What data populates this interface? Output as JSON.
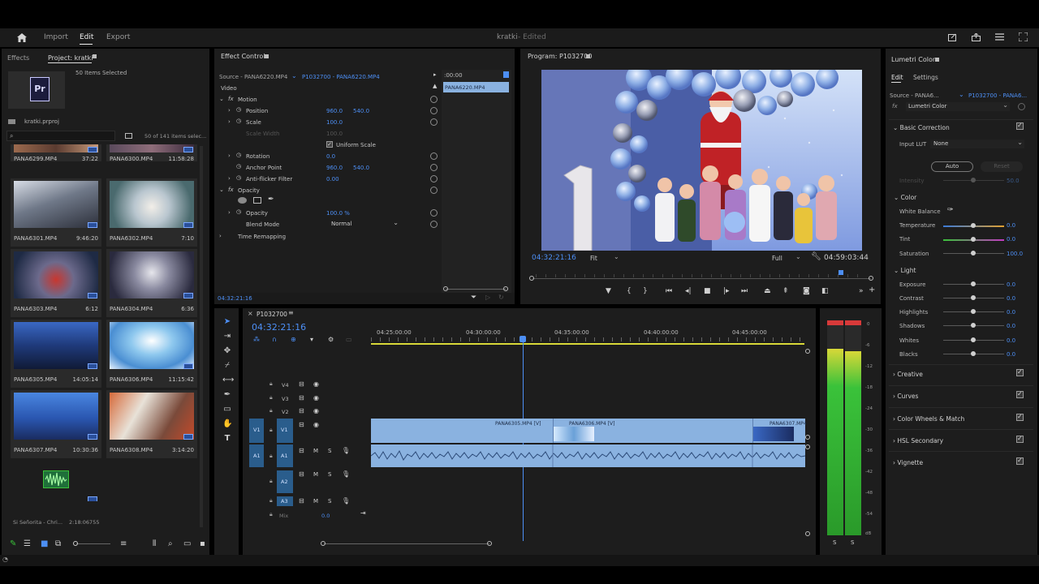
{
  "topbar": {
    "tabs": [
      {
        "label": "Import",
        "active": false
      },
      {
        "label": "Edit",
        "active": true
      },
      {
        "label": "Export",
        "active": false
      }
    ],
    "project_title": "kratki",
    "status": "- Edited"
  },
  "project_panel": {
    "tabs": [
      "Effects",
      "Project: kratki"
    ],
    "selection_info": "50 Items Selected",
    "file_name": "kratki.prproj",
    "item_count": "50 of 141 items selec...",
    "items": [
      {
        "name": "PANA6299.MP4",
        "duration": "37:22"
      },
      {
        "name": "PANA6300.MP4",
        "duration": "11:58:28"
      },
      {
        "name": "PANA6301.MP4",
        "duration": "9:46:20"
      },
      {
        "name": "PANA6302.MP4",
        "duration": "7:10"
      },
      {
        "name": "PANA6303.MP4",
        "duration": "6:12"
      },
      {
        "name": "PANA6304.MP4",
        "duration": "6:36"
      },
      {
        "name": "PANA6305.MP4",
        "duration": "14:05:14"
      },
      {
        "name": "PANA6306.MP4",
        "duration": "11:15:42"
      },
      {
        "name": "PANA6307.MP4",
        "duration": "10:30:36"
      },
      {
        "name": "PANA6308.MP4",
        "duration": "3:14:20"
      }
    ],
    "audio_item": {
      "name": "Si Señorita - Chri...",
      "duration": "2:18:06755"
    }
  },
  "effect_controls": {
    "title": "Effect Controls",
    "source": "Source - PANA6220.MP4",
    "clip": "P1032700 - PANA6220.MP4",
    "time_start": ":00:00",
    "clip_label": "PANA6220.MP4",
    "section_video": "Video",
    "motion": "Motion",
    "position_label": "Position",
    "position_x": "960.0",
    "position_y": "540.0",
    "scale_label": "Scale",
    "scale_value": "100.0",
    "scale_width_label": "Scale Width",
    "scale_width_value": "100.0",
    "uniform_scale": "Uniform Scale",
    "rotation_label": "Rotation",
    "rotation_value": "0.0",
    "anchor_label": "Anchor Point",
    "anchor_x": "960.0",
    "anchor_y": "540.0",
    "antiflicker_label": "Anti-flicker Filter",
    "antiflicker_value": "0.00",
    "opacity_section": "Opacity",
    "opacity_label": "Opacity",
    "opacity_value": "100.0 %",
    "blend_label": "Blend Mode",
    "blend_value": "Normal",
    "time_remap": "Time Remapping",
    "timecode": "04:32:21:16"
  },
  "program_monitor": {
    "title": "Program: P1032700",
    "timecode": "04:32:21:16",
    "fit": "Fit",
    "quality": "Full",
    "duration": "04:59:03:44"
  },
  "lumetri": {
    "title": "Lumetri Color",
    "tabs": [
      "Edit",
      "Settings"
    ],
    "source": "Source - PANA6...",
    "clip": "P1032700 - PANA6...",
    "effect": "Lumetri Color",
    "basic_correction": "Basic Correction",
    "input_lut_label": "Input LUT",
    "input_lut_value": "None",
    "auto": "Auto",
    "reset": "Reset",
    "intensity_label": "Intensity",
    "intensity_value": "50.0",
    "color_section": "Color",
    "white_balance": "White Balance",
    "temperature": {
      "label": "Temperature",
      "value": "0.0"
    },
    "tint": {
      "label": "Tint",
      "value": "0.0"
    },
    "saturation": {
      "label": "Saturation",
      "value": "100.0"
    },
    "light_section": "Light",
    "exposure": {
      "label": "Exposure",
      "value": "0.0"
    },
    "contrast": {
      "label": "Contrast",
      "value": "0.0"
    },
    "highlights": {
      "label": "Highlights",
      "value": "0.0"
    },
    "shadows": {
      "label": "Shadows",
      "value": "0.0"
    },
    "whites": {
      "label": "Whites",
      "value": "0.0"
    },
    "blacks": {
      "label": "Blacks",
      "value": "0.0"
    },
    "sections": [
      "Creative",
      "Curves",
      "Color Wheels & Match",
      "HSL Secondary",
      "Vignette"
    ]
  },
  "timeline": {
    "sequence": "P1032700",
    "timecode": "04:32:21:16",
    "ruler": [
      "04:25:00:00",
      "04:30:00:00",
      "04:35:00:00",
      "04:40:00:00",
      "04:45:00:00"
    ],
    "tracks_video": [
      "V4",
      "V3",
      "V2",
      "V1"
    ],
    "tracks_audio": [
      "A1",
      "A2",
      "A3"
    ],
    "source_v": "V1",
    "source_a": "A1",
    "mix_label": "Mix",
    "mix_value": "0.0",
    "clips": [
      {
        "label": "PANA6305.MP4 [V]"
      },
      {
        "label": "PANA6306.MP4 [V]"
      },
      {
        "label": "PANA6307.MP4"
      }
    ],
    "audio_meter_labels": [
      "0",
      "-6",
      "-12",
      "-18",
      "-24",
      "-30",
      "-36",
      "-42",
      "-48",
      "-54",
      "dB"
    ],
    "solo": [
      "S",
      "S"
    ]
  },
  "colors": {
    "accent": "#4d8ff5",
    "panel": "#1d1d1d",
    "clip": "#8ab2e0",
    "meter": "#3ac23a"
  }
}
